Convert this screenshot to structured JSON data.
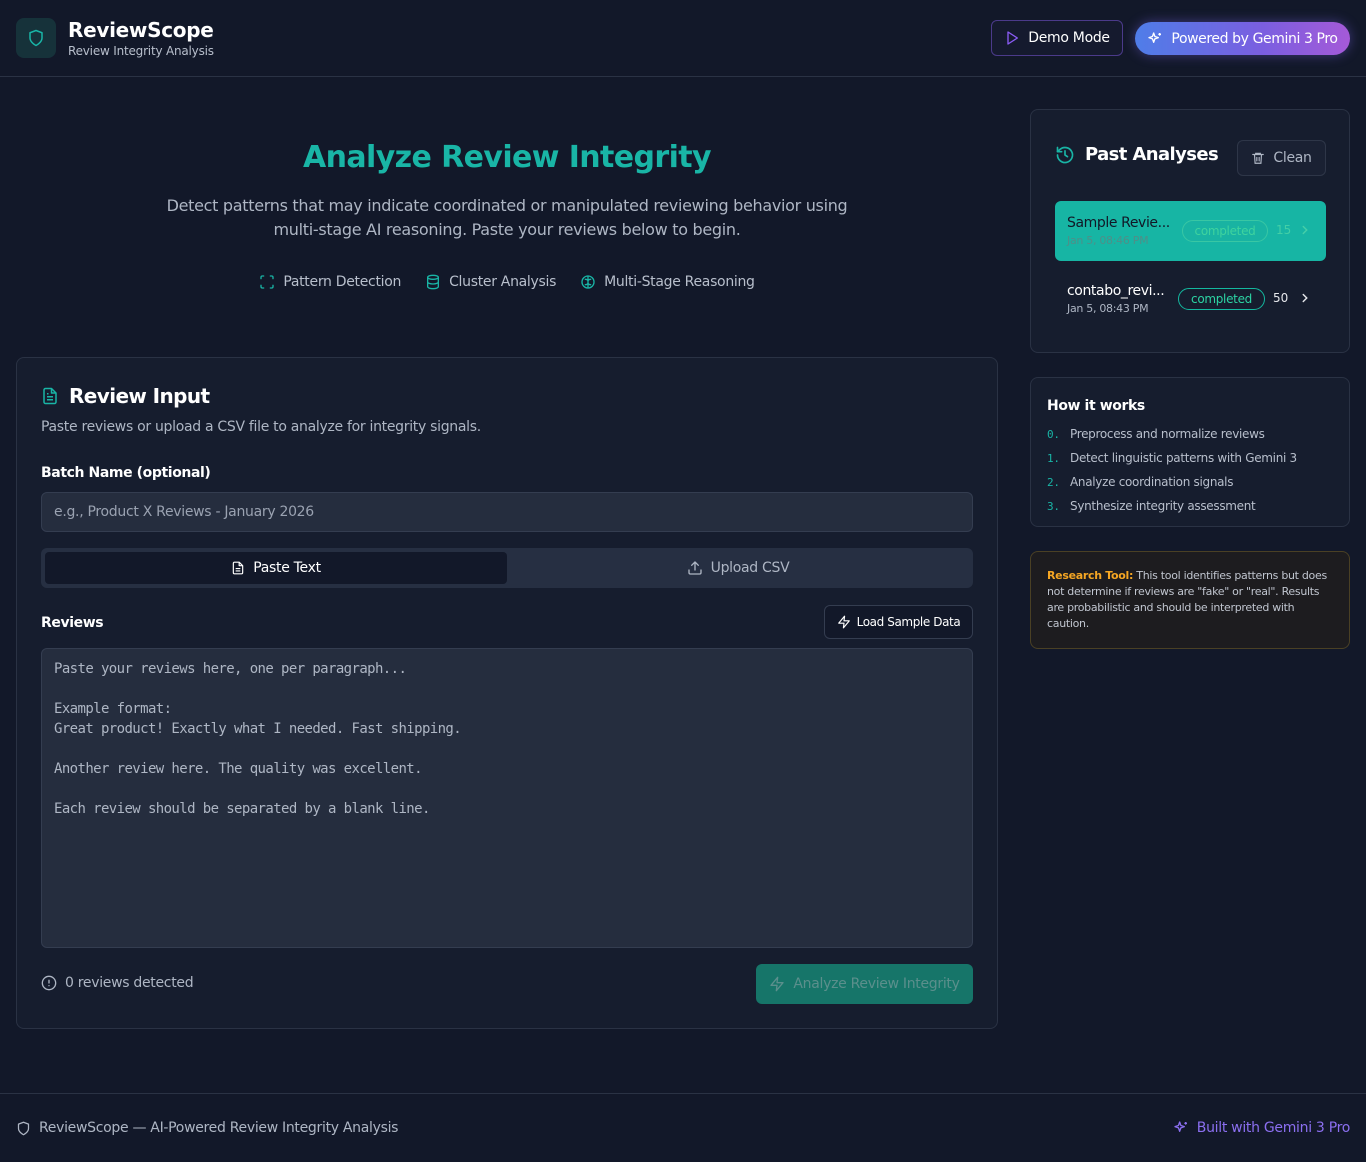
{
  "header": {
    "app_title": "ReviewScope",
    "app_subtitle": "Review Integrity Analysis",
    "demo_label": "Demo Mode",
    "gemini_label": "Powered by Gemini 3 Pro"
  },
  "hero": {
    "title": "Analyze Review Integrity",
    "description": "Detect patterns that may indicate coordinated or manipulated reviewing behavior using multi-stage AI reasoning. Paste your reviews below to begin.",
    "features": [
      "Pattern Detection",
      "Cluster Analysis",
      "Multi-Stage Reasoning"
    ]
  },
  "review_input": {
    "title": "Review Input",
    "description": "Paste reviews or upload a CSV file to analyze for integrity signals.",
    "batch_label": "Batch Name (optional)",
    "batch_placeholder": "e.g., Product X Reviews - January 2026",
    "batch_value": "",
    "tabs": [
      {
        "label": "Paste Text",
        "active": true
      },
      {
        "label": "Upload CSV",
        "active": false
      }
    ],
    "reviews_label": "Reviews",
    "load_sample_label": "Load Sample Data",
    "reviews_placeholder": "Paste your reviews here, one per paragraph...\n\nExample format:\nGreat product! Exactly what I needed. Fast shipping.\n\nAnother review here. The quality was excellent.\n\nEach review should be separated by a blank line.",
    "reviews_value": "",
    "count_text": "0 reviews detected",
    "analyze_label": "Analyze Review Integrity"
  },
  "past_analyses": {
    "title": "Past Analyses",
    "clean_label": "Clean",
    "items": [
      {
        "name": "Sample Revie...",
        "date": "Jan 5, 08:46 PM",
        "status": "completed",
        "count": "15",
        "selected": true
      },
      {
        "name": "contabo_revi...",
        "date": "Jan 5, 08:43 PM",
        "status": "completed",
        "count": "50",
        "selected": false
      }
    ]
  },
  "how_it_works": {
    "title": "How it works",
    "steps": [
      {
        "num": "0.",
        "text": "Preprocess and normalize reviews"
      },
      {
        "num": "1.",
        "text": "Detect linguistic patterns with Gemini 3"
      },
      {
        "num": "2.",
        "text": "Analyze coordination signals"
      },
      {
        "num": "3.",
        "text": "Synthesize integrity assessment"
      }
    ]
  },
  "research_note": {
    "label": "Research Tool:",
    "text": "This tool identifies patterns but does not determine if reviews are \"fake\" or \"real\". Results are probabilistic and should be interpreted with caution."
  },
  "footer": {
    "left_text": "ReviewScope — AI-Powered Review Integrity Analysis",
    "right_text": "Built with Gemini 3 Pro"
  },
  "colors": {
    "accent_teal": "#19b5a6",
    "accent_purple": "#8b6ff0",
    "warning_orange": "#f5a623",
    "background": "#121829"
  }
}
